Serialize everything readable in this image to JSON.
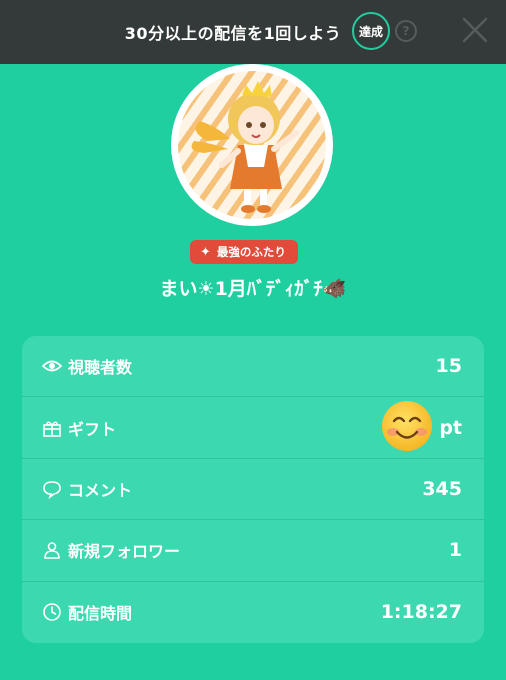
{
  "topbar": {
    "mission_text": "30分以上の配信を1回しよう",
    "achieved_label": "達成",
    "help_label": "?"
  },
  "profile": {
    "badge_label": "最強のふたり",
    "username": "まい☀1月ﾊﾞﾃﾞｨｶﾞﾁ🐗"
  },
  "stats": [
    {
      "icon": "eye-icon",
      "label": "視聴者数",
      "value": "15"
    },
    {
      "icon": "gift-icon",
      "label": "ギフト",
      "value": "pt"
    },
    {
      "icon": "comment-icon",
      "label": "コメント",
      "value": "345"
    },
    {
      "icon": "person-icon",
      "label": "新規フォロワー",
      "value": "1"
    },
    {
      "icon": "clock-icon",
      "label": "配信時間",
      "value": "1:18:27"
    }
  ],
  "colors": {
    "background": "#1fcf9f",
    "card": "#3cd8b0",
    "topbar": "#343a39",
    "badge": "#e04b3a"
  }
}
